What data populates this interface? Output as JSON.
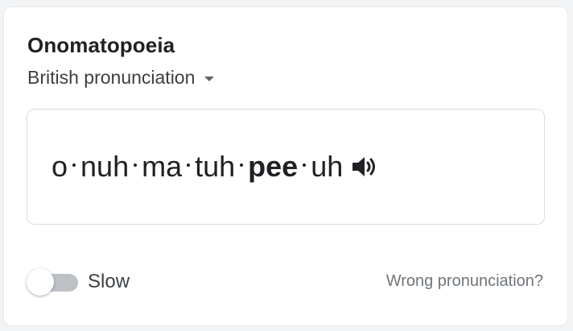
{
  "card": {
    "title": "Onomatopoeia",
    "pronunciation_select": {
      "selected": "British pronunciation"
    },
    "phonetic": {
      "syllables": [
        {
          "text": "o",
          "stressed": false
        },
        {
          "text": "nuh",
          "stressed": false
        },
        {
          "text": "ma",
          "stressed": false
        },
        {
          "text": "tuh",
          "stressed": false
        },
        {
          "text": "pee",
          "stressed": true
        },
        {
          "text": "uh",
          "stressed": false
        }
      ],
      "speaker_icon": "speaker-icon"
    },
    "slow_toggle": {
      "label": "Slow",
      "on": false
    },
    "wrong_pronunciation_link": "Wrong pronunciation?"
  },
  "colors": {
    "text_primary": "#202124",
    "text_secondary": "#70757a",
    "border": "#dadce0",
    "toggle_track_off": "#bdc1c6"
  }
}
